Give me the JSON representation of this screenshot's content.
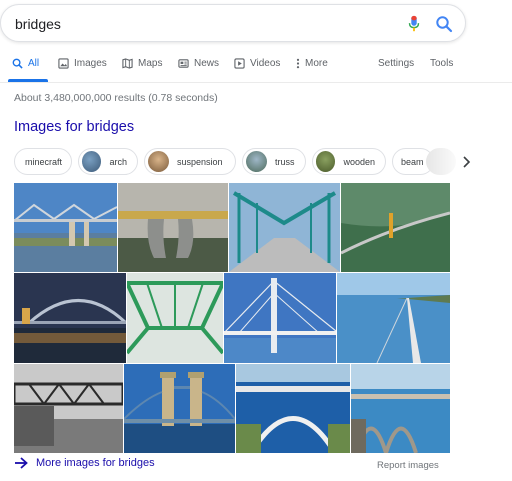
{
  "search": {
    "query": "bridges"
  },
  "tabs": {
    "all": "All",
    "images": "Images",
    "maps": "Maps",
    "news": "News",
    "videos": "Videos",
    "more": "More",
    "settings": "Settings",
    "tools": "Tools"
  },
  "stats": "About 3,480,000,000 results (0.78 seconds)",
  "images_section": {
    "title": "Images for bridges"
  },
  "chips": [
    "minecraft",
    "arch",
    "suspension",
    "truss",
    "wooden",
    "beam"
  ],
  "footer": {
    "more_images": "More images for bridges",
    "report": "Report images"
  },
  "colors": {
    "accent": "#1a73e8",
    "link": "#1a0dab",
    "mic_red": "#ea4335",
    "mic_blue": "#4285f4"
  }
}
